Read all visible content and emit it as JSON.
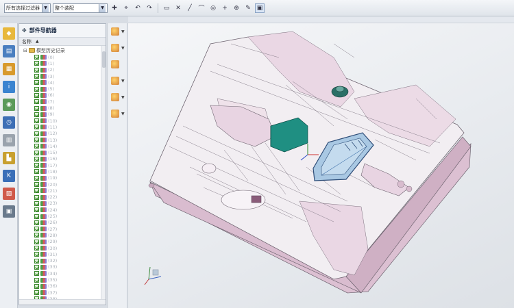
{
  "toolbar": {
    "filter_select": "所有选择过滤器",
    "assembly_select": "整个装配",
    "icons": [
      "select-filter-icon",
      "snap-point-icon",
      "undo-icon",
      "redo-icon",
      "select-rectangle-icon",
      "point-icon",
      "line-icon",
      "arc-icon",
      "circle-icon",
      "plus-icon",
      "pen-icon",
      "display-icon"
    ]
  },
  "navigator": {
    "title": "部件导航器",
    "column_name": "名称",
    "root_label": "模型历史记录",
    "items": [
      {
        "label": "(0)"
      },
      {
        "label": "(1)"
      },
      {
        "label": "(2)"
      },
      {
        "label": "(3)"
      },
      {
        "label": "(4)"
      },
      {
        "label": "(5)"
      },
      {
        "label": "(6)"
      },
      {
        "label": "(7)"
      },
      {
        "label": "(8)"
      },
      {
        "label": "(9)"
      },
      {
        "label": "(10)"
      },
      {
        "label": "(11)"
      },
      {
        "label": "(12)"
      },
      {
        "label": "(13)"
      },
      {
        "label": "(14)"
      },
      {
        "label": "(15)"
      },
      {
        "label": "(16)"
      },
      {
        "label": "(17)"
      },
      {
        "label": "(18)"
      },
      {
        "label": "(19)"
      },
      {
        "label": "(20)"
      },
      {
        "label": "(21)"
      },
      {
        "label": "(22)"
      },
      {
        "label": "(23)"
      },
      {
        "label": "(24)"
      },
      {
        "label": "(25)"
      },
      {
        "label": "(26)"
      },
      {
        "label": "(27)"
      },
      {
        "label": "(28)"
      },
      {
        "label": "(29)"
      },
      {
        "label": "(30)"
      },
      {
        "label": "(31)"
      },
      {
        "label": "(32)"
      },
      {
        "label": "(33)"
      },
      {
        "label": "(34)"
      },
      {
        "label": "(35)"
      },
      {
        "label": "(36)"
      },
      {
        "label": "(37)"
      },
      {
        "label": "(38)"
      }
    ]
  },
  "colors": {
    "mold_face": "#f2eef2",
    "mold_side": "#dcc0d2",
    "cad_edge": "#6e6470",
    "selected_face": "#1f8f82",
    "highlight_frame": "#2e4d78"
  }
}
